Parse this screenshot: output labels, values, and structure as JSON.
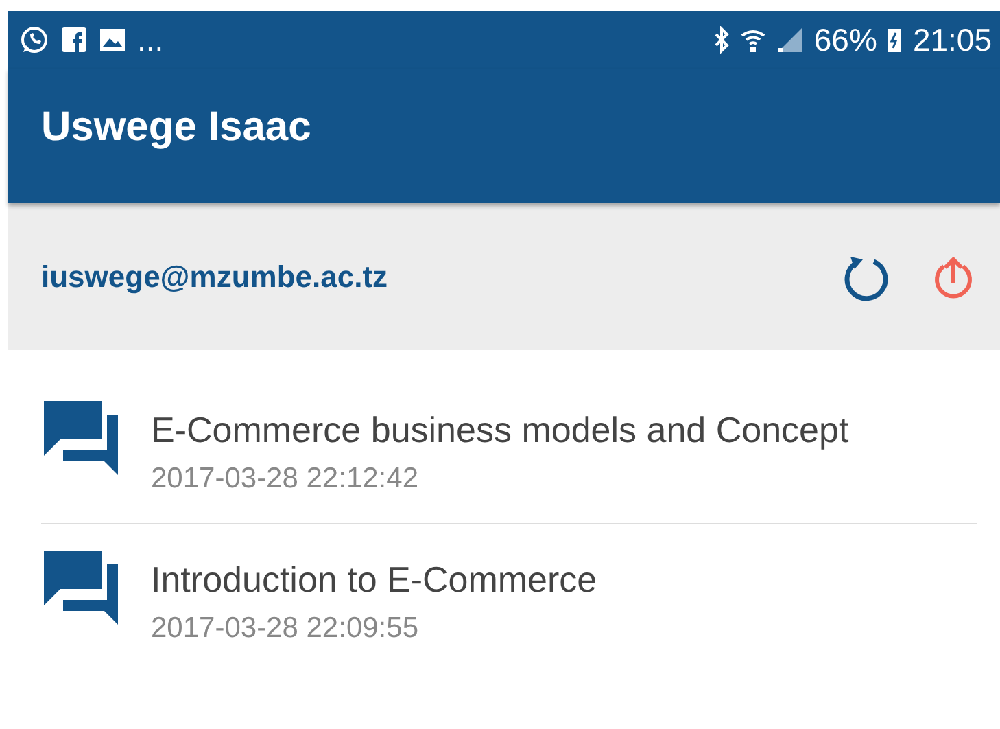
{
  "status_bar": {
    "notifications": "...",
    "battery": "66%",
    "time": "21:05"
  },
  "app_bar": {
    "title": "Uswege Isaac"
  },
  "account": {
    "email": "iuswege@mzumbe.ac.tz"
  },
  "items": [
    {
      "title": "E-Commerce business models and Concept",
      "date": "2017-03-28 22:12:42"
    },
    {
      "title": "Introduction to E-Commerce",
      "date": "2017-03-28 22:09:55"
    }
  ]
}
